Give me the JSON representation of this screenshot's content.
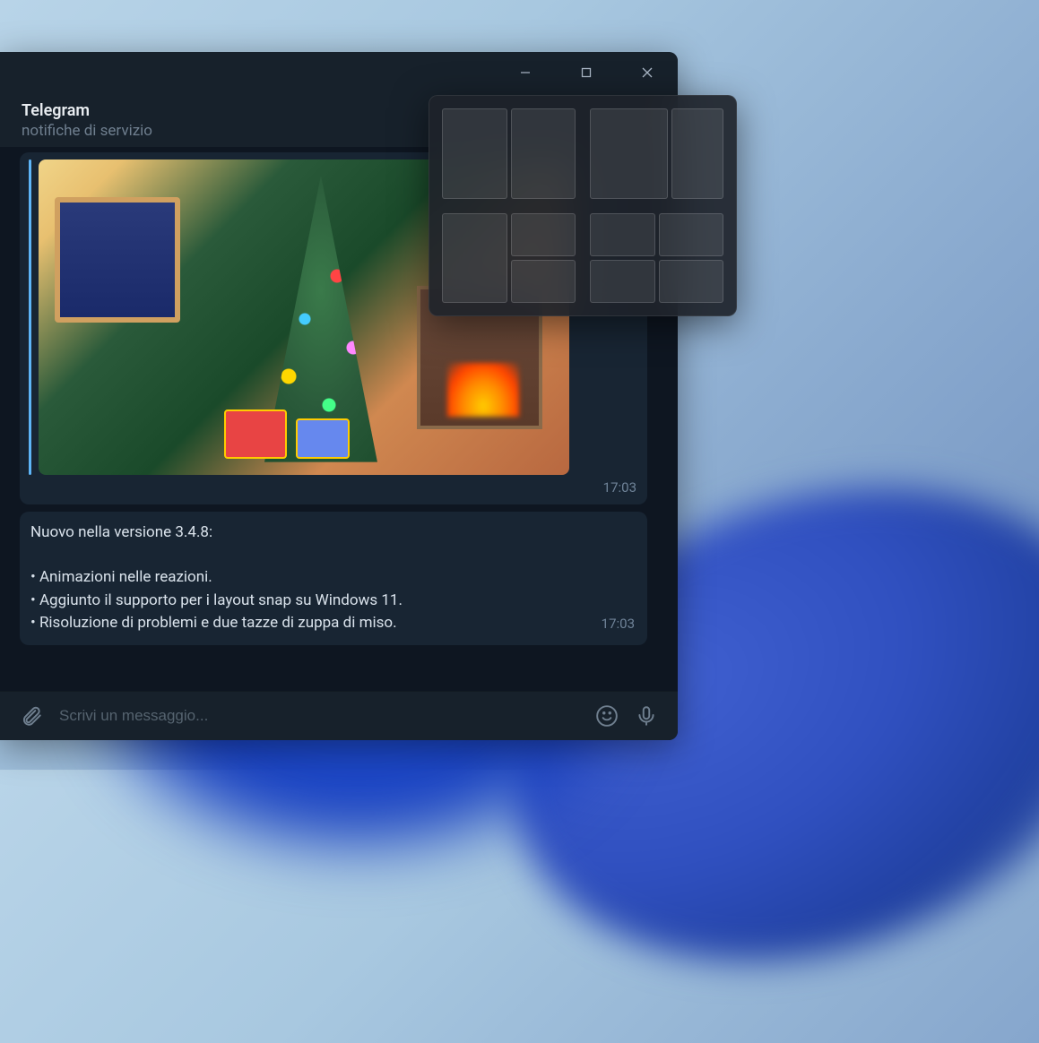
{
  "window": {
    "title": "Telegram",
    "subtitle": "notifiche di servizio"
  },
  "messages": {
    "image_time": "17:03",
    "changelog": {
      "title": "Nuovo nella versione 3.4.8:",
      "items": [
        "• Animazioni nelle reazioni.",
        "• Aggiunto il supporto per i layout snap su Windows 11.",
        "• Risoluzione di problemi e due tazze di zuppa di miso."
      ],
      "time": "17:03"
    }
  },
  "compose": {
    "placeholder": "Scrivi un messaggio..."
  },
  "snap_overlay": {
    "layouts": [
      "split-half",
      "split-two-thirds",
      "three-left-stack",
      "quadrant"
    ]
  }
}
